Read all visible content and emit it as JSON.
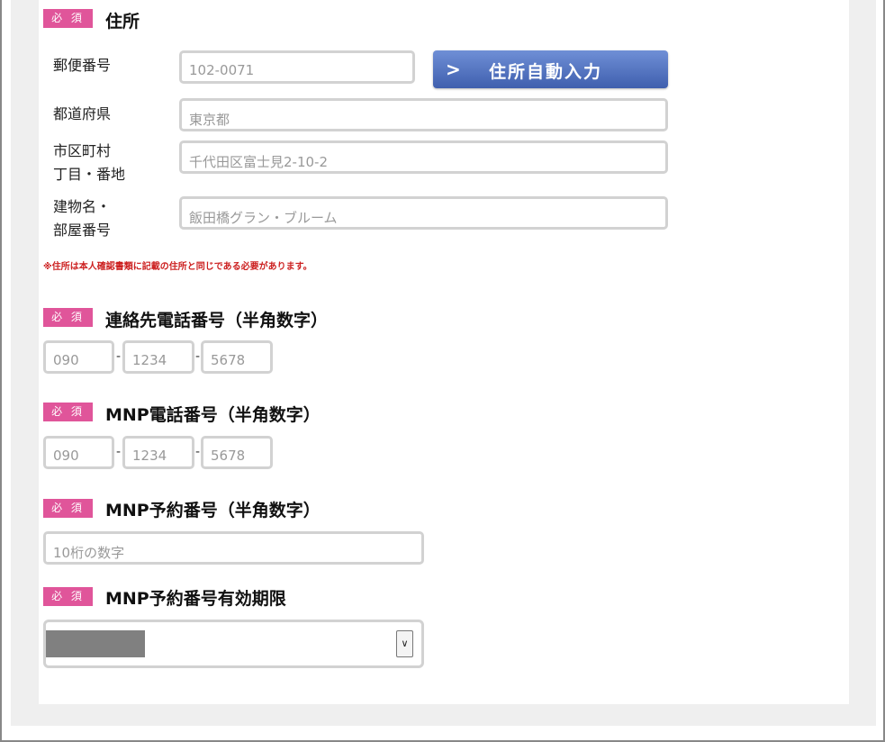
{
  "required_badge": "必 須",
  "address": {
    "heading": "住所",
    "postal_label": "郵便番号",
    "postal_placeholder": "102-0071",
    "auto_button_label": "住所自動入力",
    "prefecture_label": "都道府県",
    "prefecture_placeholder": "東京都",
    "city_label_line1": "市区町村",
    "city_label_line2": "丁目・番地",
    "city_placeholder": "千代田区富士見2-10-2",
    "building_label_line1": "建物名・",
    "building_label_line2": "部屋番号",
    "building_placeholder": "飯田橋グラン・ブルーム",
    "note": "※住所は本人確認書類に記載の住所と同じである必要があります。"
  },
  "contact_phone": {
    "heading": "連絡先電話番号（半角数字）",
    "part1_placeholder": "090",
    "part2_placeholder": "1234",
    "part3_placeholder": "5678",
    "separator": "-"
  },
  "mnp_phone": {
    "heading": "MNP電話番号（半角数字）",
    "part1_placeholder": "090",
    "part2_placeholder": "1234",
    "part3_placeholder": "5678",
    "separator": "-"
  },
  "mnp_reservation": {
    "heading": "MNP予約番号（半角数字）",
    "placeholder": "10桁の数字"
  },
  "mnp_expiry": {
    "heading": "MNP予約番号有効期限",
    "arrow_icon": "chevron-down-icon"
  },
  "colors": {
    "badge": "#e0559a",
    "button": "#4a69b8",
    "note": "#cc1f1f"
  }
}
